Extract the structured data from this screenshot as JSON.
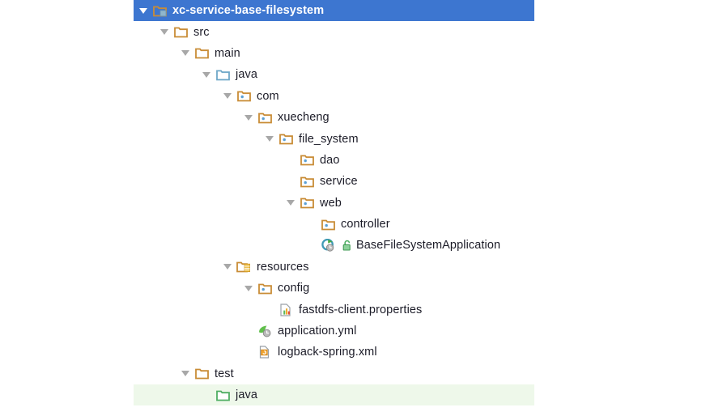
{
  "view": {
    "name": "project-tool-window",
    "background": "#ffffff",
    "selection_color": "#3d76d0",
    "marked_color": "#eef8ea",
    "text_color": "#1c1c28",
    "selected_text_color": "#ffffff"
  },
  "tree": {
    "nodes": [
      {
        "label": "xc-service-base-filesystem",
        "depth": 0,
        "arrow": "expanded",
        "icon": "module-folder-icon",
        "state": "selected"
      },
      {
        "label": "src",
        "depth": 1,
        "arrow": "expanded",
        "icon": "folder-icon",
        "state": "normal"
      },
      {
        "label": "main",
        "depth": 2,
        "arrow": "expanded",
        "icon": "folder-icon",
        "state": "normal"
      },
      {
        "label": "java",
        "depth": 3,
        "arrow": "expanded",
        "icon": "source-root-folder-icon",
        "state": "normal"
      },
      {
        "label": "com",
        "depth": 4,
        "arrow": "expanded",
        "icon": "package-folder-icon",
        "state": "normal"
      },
      {
        "label": "xuecheng",
        "depth": 5,
        "arrow": "expanded",
        "icon": "package-folder-icon",
        "state": "normal"
      },
      {
        "label": "file_system",
        "depth": 6,
        "arrow": "expanded",
        "icon": "package-folder-icon",
        "state": "normal"
      },
      {
        "label": "dao",
        "depth": 7,
        "arrow": "none",
        "icon": "package-folder-icon",
        "state": "normal"
      },
      {
        "label": "service",
        "depth": 7,
        "arrow": "none",
        "icon": "package-folder-icon",
        "state": "normal"
      },
      {
        "label": "web",
        "depth": 7,
        "arrow": "expanded",
        "icon": "package-folder-icon",
        "state": "normal"
      },
      {
        "label": "controller",
        "depth": 8,
        "arrow": "none",
        "icon": "package-folder-icon",
        "state": "normal"
      },
      {
        "label": "BaseFileSystemApplication",
        "depth": 8,
        "arrow": "none",
        "icon": "spring-boot-class-icon",
        "state": "normal",
        "badge": "public-unlocked-icon"
      },
      {
        "label": "resources",
        "depth": 4,
        "arrow": "expanded",
        "icon": "resources-root-folder-icon",
        "state": "normal"
      },
      {
        "label": "config",
        "depth": 5,
        "arrow": "expanded",
        "icon": "package-folder-icon",
        "state": "normal"
      },
      {
        "label": "fastdfs-client.properties",
        "depth": 6,
        "arrow": "none",
        "icon": "properties-file-icon",
        "state": "normal"
      },
      {
        "label": "application.yml",
        "depth": 5,
        "arrow": "none",
        "icon": "spring-yaml-file-icon",
        "state": "normal"
      },
      {
        "label": "logback-spring.xml",
        "depth": 5,
        "arrow": "none",
        "icon": "xml-file-icon",
        "state": "normal"
      },
      {
        "label": "test",
        "depth": 2,
        "arrow": "expanded",
        "icon": "folder-icon",
        "state": "normal"
      },
      {
        "label": "java",
        "depth": 3,
        "arrow": "none",
        "icon": "test-source-root-folder-icon",
        "state": "marked"
      }
    ]
  }
}
